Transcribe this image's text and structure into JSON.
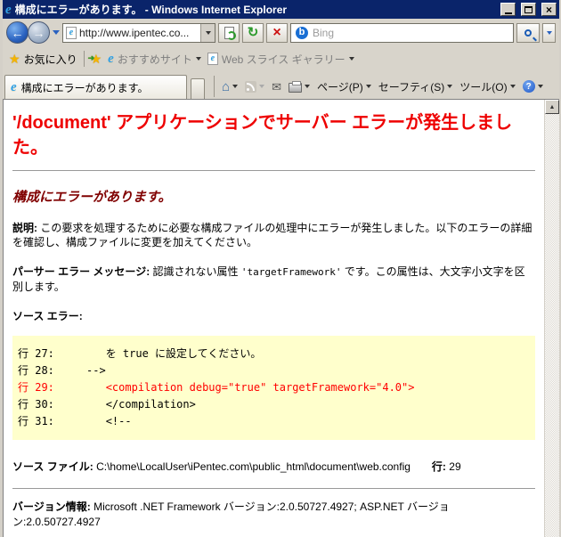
{
  "colors": {
    "titlebar_blue": "#0A246A",
    "chrome_gray": "#D4D0C8",
    "error_red": "#EE0000",
    "maroon": "#800000",
    "code_highlight_red": "#FF0000",
    "code_background_yellow": "#FFFFCC"
  },
  "icons": {
    "ie_logo": "e",
    "favorites_star": "★",
    "add_favorites_star": "★",
    "add_favorites_arrow": "➜",
    "home": "⌂",
    "mail": "✉",
    "help": "?",
    "bing": "b",
    "back_arrow": "←",
    "forward_arrow": "→",
    "refresh": "↻",
    "stop": "×",
    "close_x": "×",
    "scroll_up": "▲"
  },
  "window": {
    "title": "構成にエラーがあります。 - Windows Internet Explorer"
  },
  "nav": {
    "url": "http://www.ipentec.co...",
    "search_text": "Bing"
  },
  "favorites_bar": {
    "favorites": "お気に入り",
    "suggested_sites": "おすすめサイト",
    "web_slice_gallery": "Web スライス ギャラリー"
  },
  "tab": {
    "title": "構成にエラーがあります。"
  },
  "command_bar": {
    "page": "ページ(P)",
    "safety": "セーフティ(S)",
    "tools": "ツール(O)"
  },
  "content": {
    "h1": "'/document' アプリケーションでサーバー エラーが発生しました。",
    "h2": "構成にエラーがあります。",
    "description_label": "説明:",
    "description_text": " この要求を処理するために必要な構成ファイルの処理中にエラーが発生しました。以下のエラーの詳細を確認し、構成ファイルに変更を加えてください。",
    "parser_label": "パーサー エラー メッセージ:",
    "parser_text_before": " 認識されない属性 ",
    "parser_attr": "'targetFramework'",
    "parser_text_after": " です。この属性は、大文字小文字を区別します。",
    "source_error_label": "ソース エラー:",
    "code_lines": [
      "行 27:        を true に設定してください。",
      "行 28:     -->",
      "行 29:        <compilation debug=\"true\" targetFramework=\"4.0\">",
      "行 30:        </compilation>",
      "行 31:        <!--"
    ],
    "source_file_label": "ソース ファイル:",
    "source_file_path": " C:\\home\\LocalUser\\iPentec.com\\public_html\\document\\web.config",
    "line_label": "行:",
    "line_value": "29",
    "version_label": "バージョン情報:",
    "version_text": " Microsoft .NET Framework バージョン:2.0.50727.4927; ASP.NET バージョン:2.0.50727.4927"
  }
}
